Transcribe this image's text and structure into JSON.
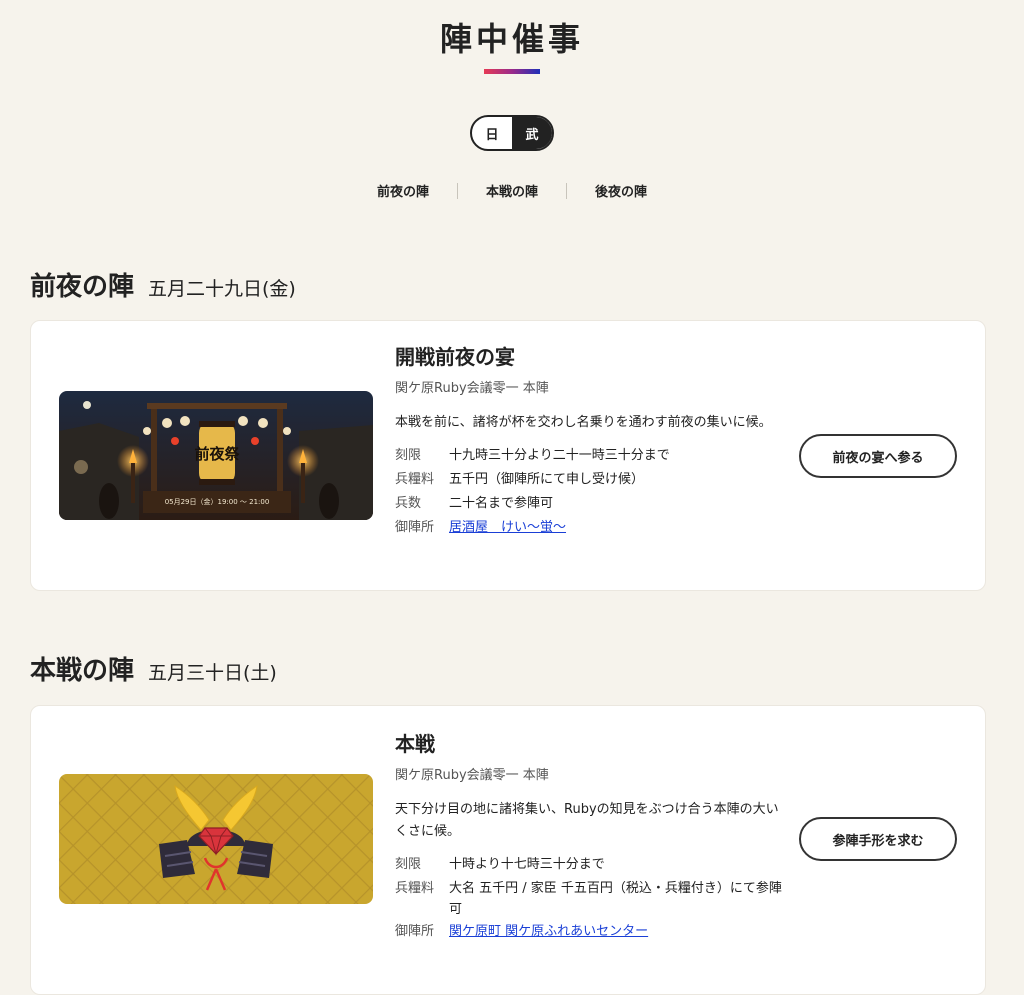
{
  "header": {
    "title": "陣中催事"
  },
  "lang_toggle": {
    "options": [
      "日",
      "武"
    ],
    "active": "武"
  },
  "nav": {
    "items": [
      "前夜の陣",
      "本戦の陣",
      "後夜の陣"
    ]
  },
  "sections": [
    {
      "day_name": "前夜の陣",
      "date": "五月二十九日(金)",
      "event": {
        "title": "開戦前夜の宴",
        "venue": "関ケ原Ruby会議零一 本陣",
        "description": "本戦を前に、諸将が杯を交わし名乗りを通わす前夜の集いに候。",
        "details": [
          {
            "label": "刻限",
            "value": "十九時三十分より二十一時三十分まで"
          },
          {
            "label": "兵糧料",
            "value": "五千円（御陣所にて申し受け候）"
          },
          {
            "label": "兵数",
            "value": "二十名まで参陣可"
          },
          {
            "label": "御陣所",
            "value": "居酒屋　けい～蛍～",
            "link": true
          }
        ],
        "cta": "前夜の宴へ参る",
        "banner": {
          "lantern_text": "前夜祭",
          "caption": "05月29日（金）19:00 〜 21:00"
        }
      }
    },
    {
      "day_name": "本戦の陣",
      "date": "五月三十日(土)",
      "event": {
        "title": "本戦",
        "venue": "関ケ原Ruby会議零一 本陣",
        "description": "天下分け目の地に諸将集い、Rubyの知見をぶつけ合う本陣の大いくさに候。",
        "details": [
          {
            "label": "刻限",
            "value": "十時より十七時三十分まで"
          },
          {
            "label": "兵糧料",
            "value": "大名 五千円 / 家臣 千五百円（税込・兵糧付き）にて参陣可"
          },
          {
            "label": "御陣所",
            "value": "関ケ原町 関ケ原ふれあいセンター",
            "link": true
          }
        ],
        "cta": "参陣手形を求む"
      }
    }
  ],
  "colors": {
    "page_bg": "#f6f3ec",
    "link": "#1a3fd6",
    "underline_start": "#e63a55",
    "underline_end": "#1f2fb8",
    "gold_banner": "#c9a62e",
    "ruby": "#d9343c"
  }
}
